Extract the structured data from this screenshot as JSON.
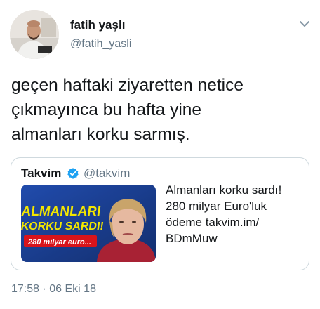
{
  "author": {
    "display_name": "fatih yaşlı",
    "handle": "@fatih_yasli",
    "avatar_icon": "user-avatar-photo"
  },
  "menu_icon": "chevron-down-icon",
  "tweet": {
    "text_lines": [
      "geçen haftaki ziyaretten netice",
      "çıkmayınca bu hafta yine",
      "almanları korku sarmış."
    ]
  },
  "quoted_tweet": {
    "display_name": "Takvim",
    "handle": "@takvim",
    "verified_icon": "verified-badge-icon",
    "thumbnail": {
      "headline_line1": "ALMANLARI",
      "headline_line2": "KORKU SARDI!",
      "subline": "280 milyar euro..."
    },
    "text_lines": [
      "Almanları korku sardı!",
      "280 milyar Euro'luk",
      "ödeme takvim.im/",
      "BDmMuw"
    ]
  },
  "timestamp": "17:58 · 06 Eki 18",
  "colors": {
    "text": "#14171a",
    "secondary": "#657786",
    "verified": "#1da1f2",
    "thumb_bg": "#1c3f9b",
    "headline_yellow": "#f2e600",
    "sub_red": "#d8141b"
  }
}
